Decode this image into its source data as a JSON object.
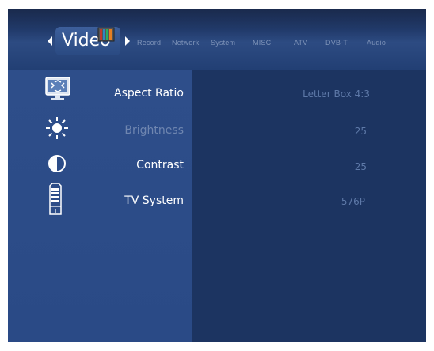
{
  "tabs": {
    "active": "Video",
    "items": [
      "Record",
      "Network",
      "System",
      "MISC",
      "ATV",
      "DVB-T",
      "Audio"
    ]
  },
  "settings": [
    {
      "label": "Aspect Ratio",
      "value": "Letter Box 4:3",
      "icon": "monitor-icon",
      "highlight": true
    },
    {
      "label": "Brightness",
      "value": "25",
      "icon": "sun-icon",
      "highlight": false
    },
    {
      "label": "Contrast",
      "value": "25",
      "icon": "contrast-icon",
      "highlight": true
    },
    {
      "label": "TV System",
      "value": "576P",
      "icon": "tv-system-icon",
      "highlight": true
    }
  ],
  "colors": {
    "label_active": "#ffffff",
    "label_dim": "#6f86b0",
    "value": "#5e79a8",
    "accent_bar": "#3d5f9b"
  }
}
